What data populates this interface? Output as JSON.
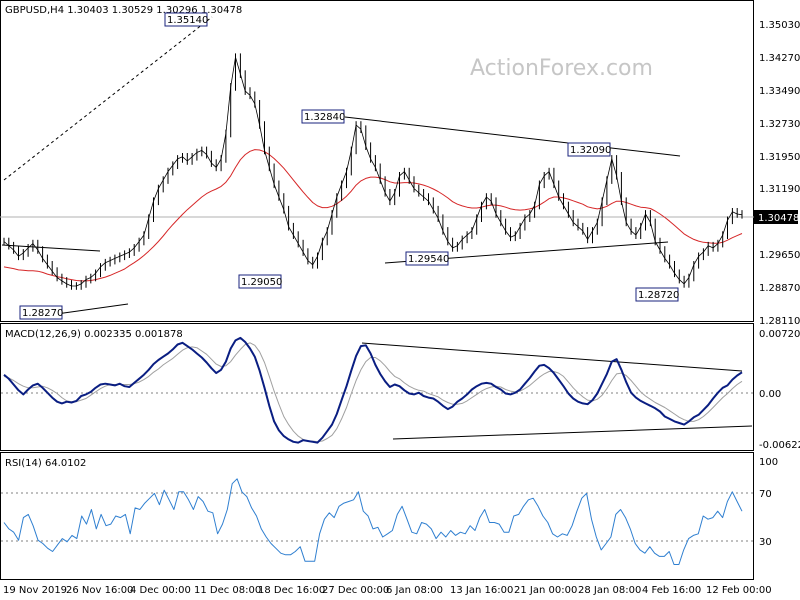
{
  "chart_data": [
    {
      "type": "line",
      "title": "GBPUSD,H4  1.30403 1.30529 1.30296 1.30478",
      "watermark": "ActionForex.com",
      "ylim": [
        1.2795,
        1.3555
      ],
      "y_ticks": [
        "1.35030",
        "1.34270",
        "1.33490",
        "1.32730",
        "1.31950",
        "1.31190",
        "1.29650",
        "1.28870",
        "1.28110"
      ],
      "last_price_label": "1.30478",
      "last_price": 1.30478,
      "moving_average": "red line",
      "price_labels": [
        "1.35140",
        "1.32840",
        "1.32090",
        "1.29540",
        "1.29050",
        "1.28720",
        "1.28270"
      ],
      "close": [
        1.2985,
        1.2975,
        1.2965,
        1.295,
        1.2958,
        1.297,
        1.298,
        1.2965,
        1.2945,
        1.293,
        1.2915,
        1.29,
        1.2892,
        1.2885,
        1.288,
        1.288,
        1.2885,
        1.2895,
        1.29,
        1.291,
        1.2925,
        1.2935,
        1.294,
        1.2945,
        1.295,
        1.2955,
        1.296,
        1.297,
        1.2985,
        1.3,
        1.304,
        1.308,
        1.311,
        1.313,
        1.315,
        1.3165,
        1.318,
        1.3185,
        1.3175,
        1.3185,
        1.3195,
        1.32,
        1.319,
        1.317,
        1.316,
        1.318,
        1.324,
        1.335,
        1.342,
        1.338,
        1.334,
        1.333,
        1.331,
        1.326,
        1.32,
        1.316,
        1.312,
        1.309,
        1.306,
        1.302,
        1.3,
        1.298,
        1.296,
        1.294,
        1.293,
        1.295,
        1.2985,
        1.301,
        1.305,
        1.309,
        1.312,
        1.315,
        1.32,
        1.326,
        1.325,
        1.321,
        1.318,
        1.316,
        1.313,
        1.31,
        1.308,
        1.31,
        1.314,
        1.315,
        1.313,
        1.311,
        1.31,
        1.309,
        1.308,
        1.306,
        1.304,
        1.301,
        1.2985,
        1.297,
        1.2975,
        1.299,
        1.3,
        1.301,
        1.304,
        1.307,
        1.309,
        1.308,
        1.305,
        1.303,
        1.301,
        1.2995,
        1.3,
        1.302,
        1.304,
        1.305,
        1.307,
        1.312,
        1.314,
        1.315,
        1.312,
        1.309,
        1.307,
        1.305,
        1.303,
        1.302,
        1.301,
        1.299,
        1.301,
        1.303,
        1.308,
        1.313,
        1.318,
        1.314,
        1.308,
        1.303,
        1.301,
        1.3,
        1.302,
        1.305,
        1.303,
        1.2985,
        1.2965,
        1.2945,
        1.293,
        1.291,
        1.2895,
        1.2885,
        1.29,
        1.293,
        1.295,
        1.296,
        1.2975,
        1.297,
        1.298,
        1.3,
        1.3035,
        1.3055,
        1.305,
        1.3048
      ],
      "ma": [
        1.2925,
        1.2923,
        1.2921,
        1.2918,
        1.2917,
        1.2916,
        1.2916,
        1.2915,
        1.2912,
        1.2908,
        1.2905,
        1.2902,
        1.29,
        1.2897,
        1.2895,
        1.2893,
        1.2892,
        1.2892,
        1.2893,
        1.2895,
        1.2898,
        1.2901,
        1.2905,
        1.291,
        1.2915,
        1.292,
        1.2928,
        1.2935,
        1.2943,
        1.2952,
        1.2962,
        1.2973,
        1.2985,
        1.2998,
        1.3012,
        1.3025,
        1.3037,
        1.3049,
        1.306,
        1.307,
        1.308,
        1.309,
        1.3098,
        1.3104,
        1.3109,
        1.3115,
        1.3125,
        1.314,
        1.316,
        1.3178,
        1.319,
        1.3198,
        1.3202,
        1.3201,
        1.3197,
        1.319,
        1.3181,
        1.317,
        1.3158,
        1.3144,
        1.313,
        1.3116,
        1.3102,
        1.3089,
        1.3077,
        1.3069,
        1.3065,
        1.3065,
        1.3068,
        1.3074,
        1.3082,
        1.3092,
        1.3104,
        1.3118,
        1.3128,
        1.3134,
        1.3137,
        1.3137,
        1.3135,
        1.3131,
        1.3126,
        1.3123,
        1.3123,
        1.3124,
        1.3124,
        1.3123,
        1.3121,
        1.3118,
        1.3114,
        1.3109,
        1.3103,
        1.3096,
        1.3088,
        1.3079,
        1.3073,
        1.3069,
        1.3066,
        1.3064,
        1.3064,
        1.3066,
        1.3069,
        1.3071,
        1.3071,
        1.3069,
        1.3066,
        1.3062,
        1.306,
        1.3059,
        1.306,
        1.3062,
        1.3065,
        1.3071,
        1.3078,
        1.3086,
        1.309,
        1.309,
        1.3088,
        1.3085,
        1.3081,
        1.3077,
        1.3073,
        1.3067,
        1.3064,
        1.3062,
        1.3064,
        1.3068,
        1.3075,
        1.308,
        1.308,
        1.3077,
        1.3073,
        1.3069,
        1.3066,
        1.3065,
        1.3063,
        1.3057,
        1.305,
        1.3042,
        1.3033,
        1.3023,
        1.3013,
        1.3003,
        1.2996,
        1.299,
        1.2986,
        1.2983,
        1.2982,
        1.2981,
        1.2981,
        1.2983,
        1.2988,
        1.2994,
        1.2999,
        1.3004
      ]
    },
    {
      "type": "line",
      "title": "MACD(12,26,9) 0.002335 0.001878",
      "ylim": [
        -0.0072,
        0.0082
      ],
      "y_ticks": [
        "0.007201",
        "0.00",
        "-0.006229"
      ],
      "macd": [
        0.002,
        0.0015,
        0.0008,
        0.0001,
        -0.0004,
        0.0002,
        0.0007,
        0.0009,
        0.0004,
        -0.0002,
        -0.0008,
        -0.0013,
        -0.0015,
        -0.0013,
        -0.0014,
        -0.0012,
        -0.0006,
        -0.0004,
        -0.0001,
        0.0004,
        0.0008,
        0.0009,
        0.0008,
        0.0007,
        0.0009,
        0.0006,
        0.0005,
        0.001,
        0.0015,
        0.002,
        0.0026,
        0.0033,
        0.0038,
        0.0042,
        0.0046,
        0.0051,
        0.0057,
        0.0059,
        0.0055,
        0.0051,
        0.0046,
        0.0041,
        0.0035,
        0.0028,
        0.0022,
        0.0026,
        0.0036,
        0.0052,
        0.0062,
        0.0065,
        0.006,
        0.0052,
        0.0042,
        0.0025,
        0.0004,
        -0.0018,
        -0.0037,
        -0.0048,
        -0.0055,
        -0.0059,
        -0.0062,
        -0.0063,
        -0.006,
        -0.0061,
        -0.0062,
        -0.0063,
        -0.0057,
        -0.0049,
        -0.0041,
        -0.0028,
        -0.0011,
        0.0006,
        0.0025,
        0.0043,
        0.0055,
        0.0056,
        0.0046,
        0.0032,
        0.0021,
        0.0012,
        0.0005,
        0.0008,
        0.0006,
        0.0001,
        -0.0003,
        -0.0004,
        -0.0002,
        -0.0006,
        -0.0008,
        -0.0009,
        -0.0013,
        -0.0018,
        -0.0022,
        -0.0019,
        -0.0013,
        -0.0009,
        -0.0004,
        0.0002,
        0.0006,
        0.0009,
        0.001,
        0.0009,
        0.0005,
        0.0002,
        -0.0003,
        -0.0004,
        -0.0002,
        0.0002,
        0.0009,
        0.0016,
        0.0024,
        0.0031,
        0.0032,
        0.0028,
        0.0022,
        0.0014,
        0.0006,
        -0.0003,
        -0.0009,
        -0.0013,
        -0.0015,
        -0.0016,
        -0.0011,
        -0.0003,
        0.0009,
        0.0021,
        0.0036,
        0.0039,
        0.0026,
        0.0011,
        -0.0002,
        -0.0008,
        -0.0012,
        -0.0015,
        -0.0018,
        -0.0021,
        -0.0025,
        -0.0031,
        -0.0034,
        -0.0037,
        -0.0039,
        -0.0041,
        -0.0037,
        -0.0032,
        -0.0029,
        -0.0023,
        -0.0017,
        -0.0009,
        -0.0002,
        0.0004,
        0.0007,
        0.0014,
        0.0019,
        0.0023
      ],
      "signal": [
        0.0018,
        0.0016,
        0.0013,
        0.0009,
        0.0006,
        0.0004,
        0.0004,
        0.0005,
        0.0006,
        0.0004,
        0.0001,
        -0.0003,
        -0.0008,
        -0.0012,
        -0.0013,
        -0.0013,
        -0.0011,
        -0.0009,
        -0.0005,
        -0.0001,
        0.0003,
        0.0006,
        0.0008,
        0.0008,
        0.0008,
        0.0008,
        0.0008,
        0.0009,
        0.0011,
        0.0014,
        0.0018,
        0.0023,
        0.0027,
        0.0032,
        0.0036,
        0.004,
        0.0045,
        0.005,
        0.0053,
        0.0054,
        0.0053,
        0.0049,
        0.0045,
        0.0039,
        0.0033,
        0.003,
        0.0031,
        0.0036,
        0.0044,
        0.0051,
        0.0057,
        0.0059,
        0.0056,
        0.0048,
        0.0035,
        0.0018,
        0.0,
        -0.0016,
        -0.0031,
        -0.0041,
        -0.0049,
        -0.0055,
        -0.0059,
        -0.0061,
        -0.0061,
        -0.0062,
        -0.0061,
        -0.0058,
        -0.0054,
        -0.0046,
        -0.0034,
        -0.002,
        -0.0003,
        0.0013,
        0.0026,
        0.0036,
        0.0041,
        0.0041,
        0.0037,
        0.0031,
        0.0024,
        0.0018,
        0.0015,
        0.001,
        0.0006,
        0.0003,
        0.0001,
        0.0,
        -0.0003,
        -0.0005,
        -0.0007,
        -0.0011,
        -0.0014,
        -0.0016,
        -0.0016,
        -0.0015,
        -0.0012,
        -0.0008,
        -0.0004,
        0.0,
        0.0003,
        0.0005,
        0.0006,
        0.0005,
        0.0002,
        0.0,
        -0.0001,
        0.0,
        0.0003,
        0.0007,
        0.0012,
        0.0017,
        0.0021,
        0.0024,
        0.0024,
        0.0022,
        0.0018,
        0.0011,
        0.0004,
        -0.0002,
        -0.0007,
        -0.0011,
        -0.0012,
        -0.001,
        -0.0005,
        0.0003,
        0.0013,
        0.0021,
        0.0022,
        0.0019,
        0.0013,
        0.0006,
        -0.0001,
        -0.0006,
        -0.001,
        -0.0014,
        -0.0017,
        -0.002,
        -0.0024,
        -0.0028,
        -0.0032,
        -0.0035,
        -0.0037,
        -0.0037,
        -0.0035,
        -0.0031,
        -0.0026,
        -0.002,
        -0.0014,
        -0.0008,
        -0.0003,
        0.0003,
        0.0008,
        0.0012
      ]
    },
    {
      "type": "line",
      "title": "RSI(14) 64.0102",
      "ylim": [
        22,
        100
      ],
      "y_ticks": [
        "100",
        "70",
        "30"
      ],
      "levels": [
        70,
        30
      ],
      "rsi": [
        57,
        53,
        51,
        46,
        60,
        62,
        55,
        46,
        44,
        41,
        39,
        43,
        47,
        45,
        49,
        47,
        61,
        56,
        65,
        53,
        62,
        55,
        56,
        61,
        60,
        62,
        50,
        66,
        65,
        69,
        72,
        75,
        68,
        77,
        71,
        65,
        76,
        76,
        71,
        65,
        73,
        70,
        64,
        63,
        50,
        56,
        65,
        81,
        84,
        76,
        73,
        66,
        61,
        53,
        48,
        44,
        41,
        38,
        37,
        37,
        39,
        42,
        33,
        33,
        33,
        50,
        59,
        63,
        60,
        67,
        69,
        70,
        71,
        76,
        64,
        61,
        53,
        54,
        48,
        50,
        52,
        62,
        67,
        59,
        51,
        50,
        57,
        56,
        53,
        47,
        51,
        48,
        52,
        49,
        51,
        50,
        55,
        52,
        60,
        65,
        57,
        57,
        56,
        51,
        51,
        61,
        62,
        67,
        71,
        72,
        67,
        61,
        57,
        50,
        48,
        50,
        49,
        55,
        64,
        72,
        75,
        59,
        48,
        40,
        44,
        48,
        62,
        65,
        60,
        53,
        44,
        40,
        38,
        42,
        38,
        36,
        36,
        39,
        31,
        31,
        40,
        47,
        49,
        50,
        61,
        59,
        60,
        64,
        60,
        70,
        76,
        70,
        64
      ]
    }
  ],
  "x_labels": [
    "19 Nov 2019",
    "26 Nov 16:00",
    "4 Dec 00:00",
    "11 Dec 08:00",
    "18 Dec 16:00",
    "27 Dec 00:00",
    "6 Jan 08:00",
    "13 Jan 16:00",
    "21 Jan 00:00",
    "28 Jan 08:00",
    "4 Feb 16:00",
    "12 Feb 00:00"
  ],
  "colors": {
    "price": "#000000",
    "ma": "#d62728",
    "macd": "#0a1e82",
    "signal": "#a0a0a0",
    "rsi": "#2f7fd0",
    "grid": "#808080",
    "label_border": "#1a237e"
  }
}
